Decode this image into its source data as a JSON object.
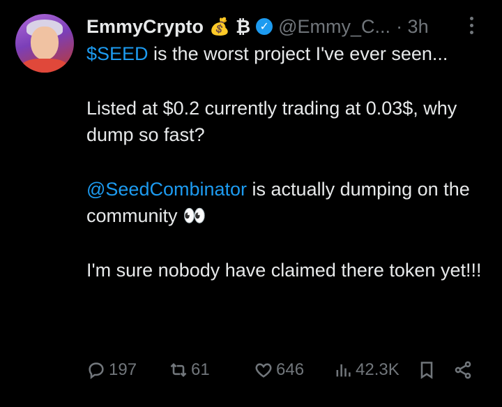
{
  "tweet": {
    "author_name": "EmmyCrypto",
    "badges": [
      "money-bag-emoji",
      "bitcoin-symbol"
    ],
    "name_emoji": "💰",
    "name_symbol": "₿",
    "handle": "@Emmy_C...",
    "time": "· 3h",
    "text": {
      "p1_link": "$SEED",
      "p1_rest": " is the worst project I've ever seen...",
      "p2": "Listed at $0.2 currently trading at 0.03$, why dump so fast?",
      "p3_link": "@SeedCombinator",
      "p3_rest": " is actually dumping on the community ",
      "p3_emoji": "👀",
      "p4": "I'm sure nobody have claimed there token yet!!!"
    },
    "stats": {
      "replies": "197",
      "reposts": "61",
      "likes": "646",
      "views": "42.3K"
    }
  },
  "colors": {
    "background": "#000000",
    "text": "#e7e9ea",
    "muted": "#71767b",
    "link": "#1d9bf0",
    "verified": "#1d9bf0"
  },
  "icons": [
    "reply-icon",
    "repost-icon",
    "like-icon",
    "views-icon",
    "bookmark-icon",
    "share-icon",
    "more-icon",
    "verified-icon"
  ]
}
